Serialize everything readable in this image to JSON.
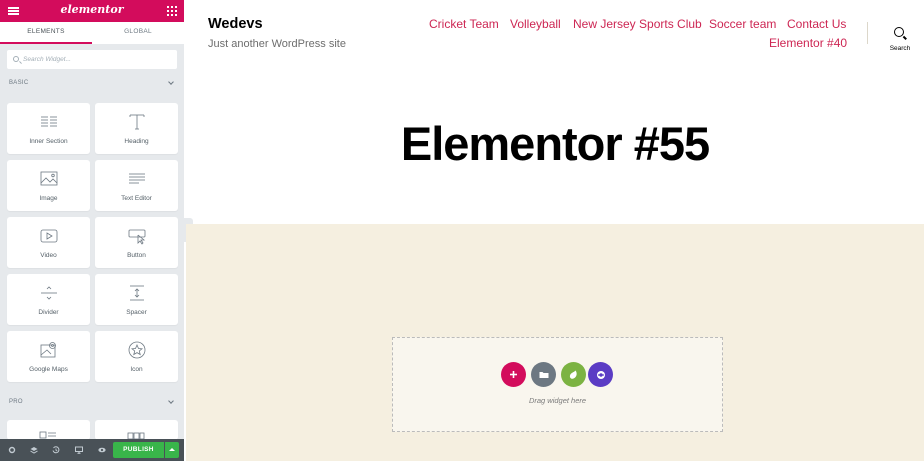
{
  "panel": {
    "logo": "elementor",
    "tabs": [
      {
        "label": "ELEMENTS"
      },
      {
        "label": "GLOBAL"
      }
    ],
    "search": {
      "placeholder": "Search Widget..."
    },
    "categories": [
      {
        "title": "BASIC"
      },
      {
        "title": "PRO"
      }
    ],
    "widgets": [
      {
        "label": "Inner Section",
        "icon": "inner-section-icon"
      },
      {
        "label": "Heading",
        "icon": "heading-icon"
      },
      {
        "label": "Image",
        "icon": "image-icon"
      },
      {
        "label": "Text Editor",
        "icon": "text-editor-icon"
      },
      {
        "label": "Video",
        "icon": "video-icon"
      },
      {
        "label": "Button",
        "icon": "button-icon"
      },
      {
        "label": "Divider",
        "icon": "divider-icon"
      },
      {
        "label": "Spacer",
        "icon": "spacer-icon"
      },
      {
        "label": "Google Maps",
        "icon": "google-maps-icon"
      },
      {
        "label": "Icon",
        "icon": "star-icon"
      }
    ],
    "footer": {
      "publish_label": "PUBLISH"
    }
  },
  "site": {
    "title": "Wedevs",
    "description": "Just another WordPress site",
    "nav": [
      {
        "label": "Cricket Team"
      },
      {
        "label": "Volleyball"
      },
      {
        "label": "New Jersey Sports Club"
      },
      {
        "label": "Soccer team"
      },
      {
        "label": "Contact Us"
      },
      {
        "label": "Elementor #40"
      }
    ],
    "search_label": "Search"
  },
  "page": {
    "title": "Elementor #55",
    "dropzone_text": "Drag widget here"
  },
  "colors": {
    "brand": "#d30c5c",
    "publish": "#39b54a",
    "nav_link": "#cd2653",
    "content_bg": "#f5efe0",
    "add_button": "#d30c5c",
    "template_button": "#6d7882",
    "envato_button": "#7cb342",
    "kit_button": "#5b3cc4"
  }
}
